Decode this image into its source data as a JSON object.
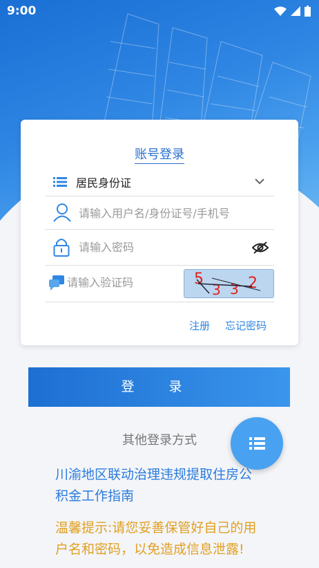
{
  "status": {
    "time": "9:00"
  },
  "login": {
    "title": "账号登录",
    "id_type": "居民身份证",
    "username_placeholder": "请输入用户名/身份证号/手机号",
    "password_placeholder": "请输入密码",
    "captcha_placeholder": "请输入验证码",
    "captcha_text": "5332",
    "register": "注册",
    "forgot": "忘记密码",
    "submit": "登 录"
  },
  "other_methods": "其他登录方式",
  "guide_link": "川渝地区联动治理违规提取住房公积金工作指南",
  "tip": "温馨提示:请您妥善保管好自己的用户名和密码，以免造成信息泄露!",
  "colors": {
    "primary": "#2f86e3",
    "tip": "#e0a020"
  }
}
